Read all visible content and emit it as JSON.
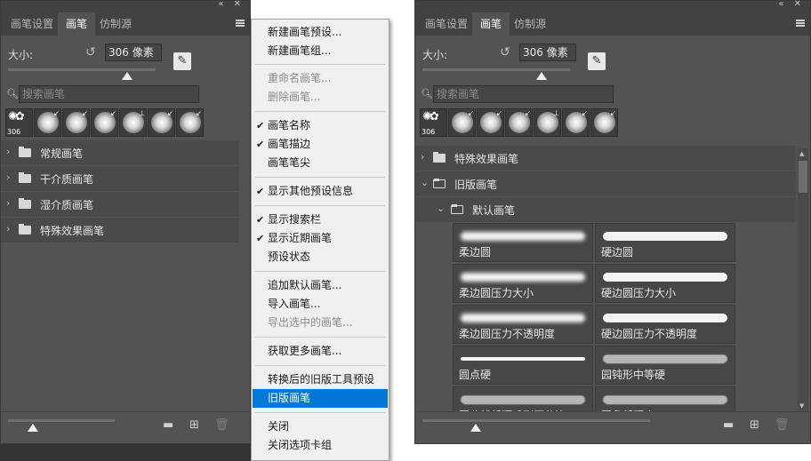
{
  "left_panel": {
    "window_buttons": "«  ✕",
    "tabs": [
      "画笔设置",
      "画笔",
      "仿制源"
    ],
    "active_tab": 1,
    "size_label": "大小:",
    "size_value": "306 像素",
    "search_placeholder": "搜索画笔",
    "recent_count": "306",
    "groups": [
      "常规画笔",
      "干介质画笔",
      "湿介质画笔",
      "特殊效果画笔"
    ]
  },
  "context_menu": {
    "items": [
      {
        "label": "新建画笔预设...",
        "state": "normal",
        "checked": false
      },
      {
        "label": "新建画笔组...",
        "state": "normal",
        "checked": false
      },
      {
        "label": "重命名画笔...",
        "state": "disabled",
        "checked": false
      },
      {
        "label": "删除画笔...",
        "state": "disabled",
        "checked": false
      },
      {
        "label": "画笔名称",
        "state": "normal",
        "checked": true
      },
      {
        "label": "画笔描边",
        "state": "normal",
        "checked": true
      },
      {
        "label": "画笔笔尖",
        "state": "normal",
        "checked": false
      },
      {
        "label": "显示其他预设信息",
        "state": "normal",
        "checked": true
      },
      {
        "label": "显示搜索栏",
        "state": "normal",
        "checked": true
      },
      {
        "label": "显示近期画笔",
        "state": "normal",
        "checked": true
      },
      {
        "label": "预设状态",
        "state": "normal",
        "checked": false
      },
      {
        "label": "追加默认画笔...",
        "state": "normal",
        "checked": false
      },
      {
        "label": "导入画笔...",
        "state": "normal",
        "checked": false
      },
      {
        "label": "导出选中的画笔...",
        "state": "disabled",
        "checked": false
      },
      {
        "label": "获取更多画笔...",
        "state": "normal",
        "checked": false
      },
      {
        "label": "转换后的旧版工具预设",
        "state": "normal",
        "checked": false
      },
      {
        "label": "旧版画笔",
        "state": "selected",
        "checked": false
      },
      {
        "label": "关闭",
        "state": "normal",
        "checked": false
      },
      {
        "label": "关闭选项卡组",
        "state": "normal",
        "checked": false
      }
    ]
  },
  "right_panel": {
    "window_buttons": "«  ✕",
    "tabs": [
      "画笔设置",
      "画笔",
      "仿制源"
    ],
    "active_tab": 1,
    "size_label": "大小:",
    "size_value": "306 像素",
    "search_placeholder": "搜索画笔",
    "recent_count": "306",
    "groups": [
      {
        "label": "特殊效果画笔",
        "expanded": false,
        "level": 0
      },
      {
        "label": "旧版画笔",
        "expanded": true,
        "level": 0
      },
      {
        "label": "默认画笔",
        "expanded": true,
        "level": 1
      }
    ],
    "brushes": [
      {
        "name": "柔边圆",
        "style": "soft"
      },
      {
        "name": "硬边圆",
        "style": "hard"
      },
      {
        "name": "柔边圆压力大小",
        "style": "soft"
      },
      {
        "name": "硬边圆压力大小",
        "style": "hard"
      },
      {
        "name": "柔边圆压力不透明度",
        "style": "soft"
      },
      {
        "name": "硬边圆压力不透明度",
        "style": "hard"
      },
      {
        "name": "圆点硬",
        "style": "thin"
      },
      {
        "name": "园钝形中等硬",
        "style": "rough"
      },
      {
        "name": "圆曲线低硬毛刷百分比",
        "style": "rough"
      },
      {
        "name": "圆角低硬度",
        "style": "rough"
      }
    ]
  }
}
